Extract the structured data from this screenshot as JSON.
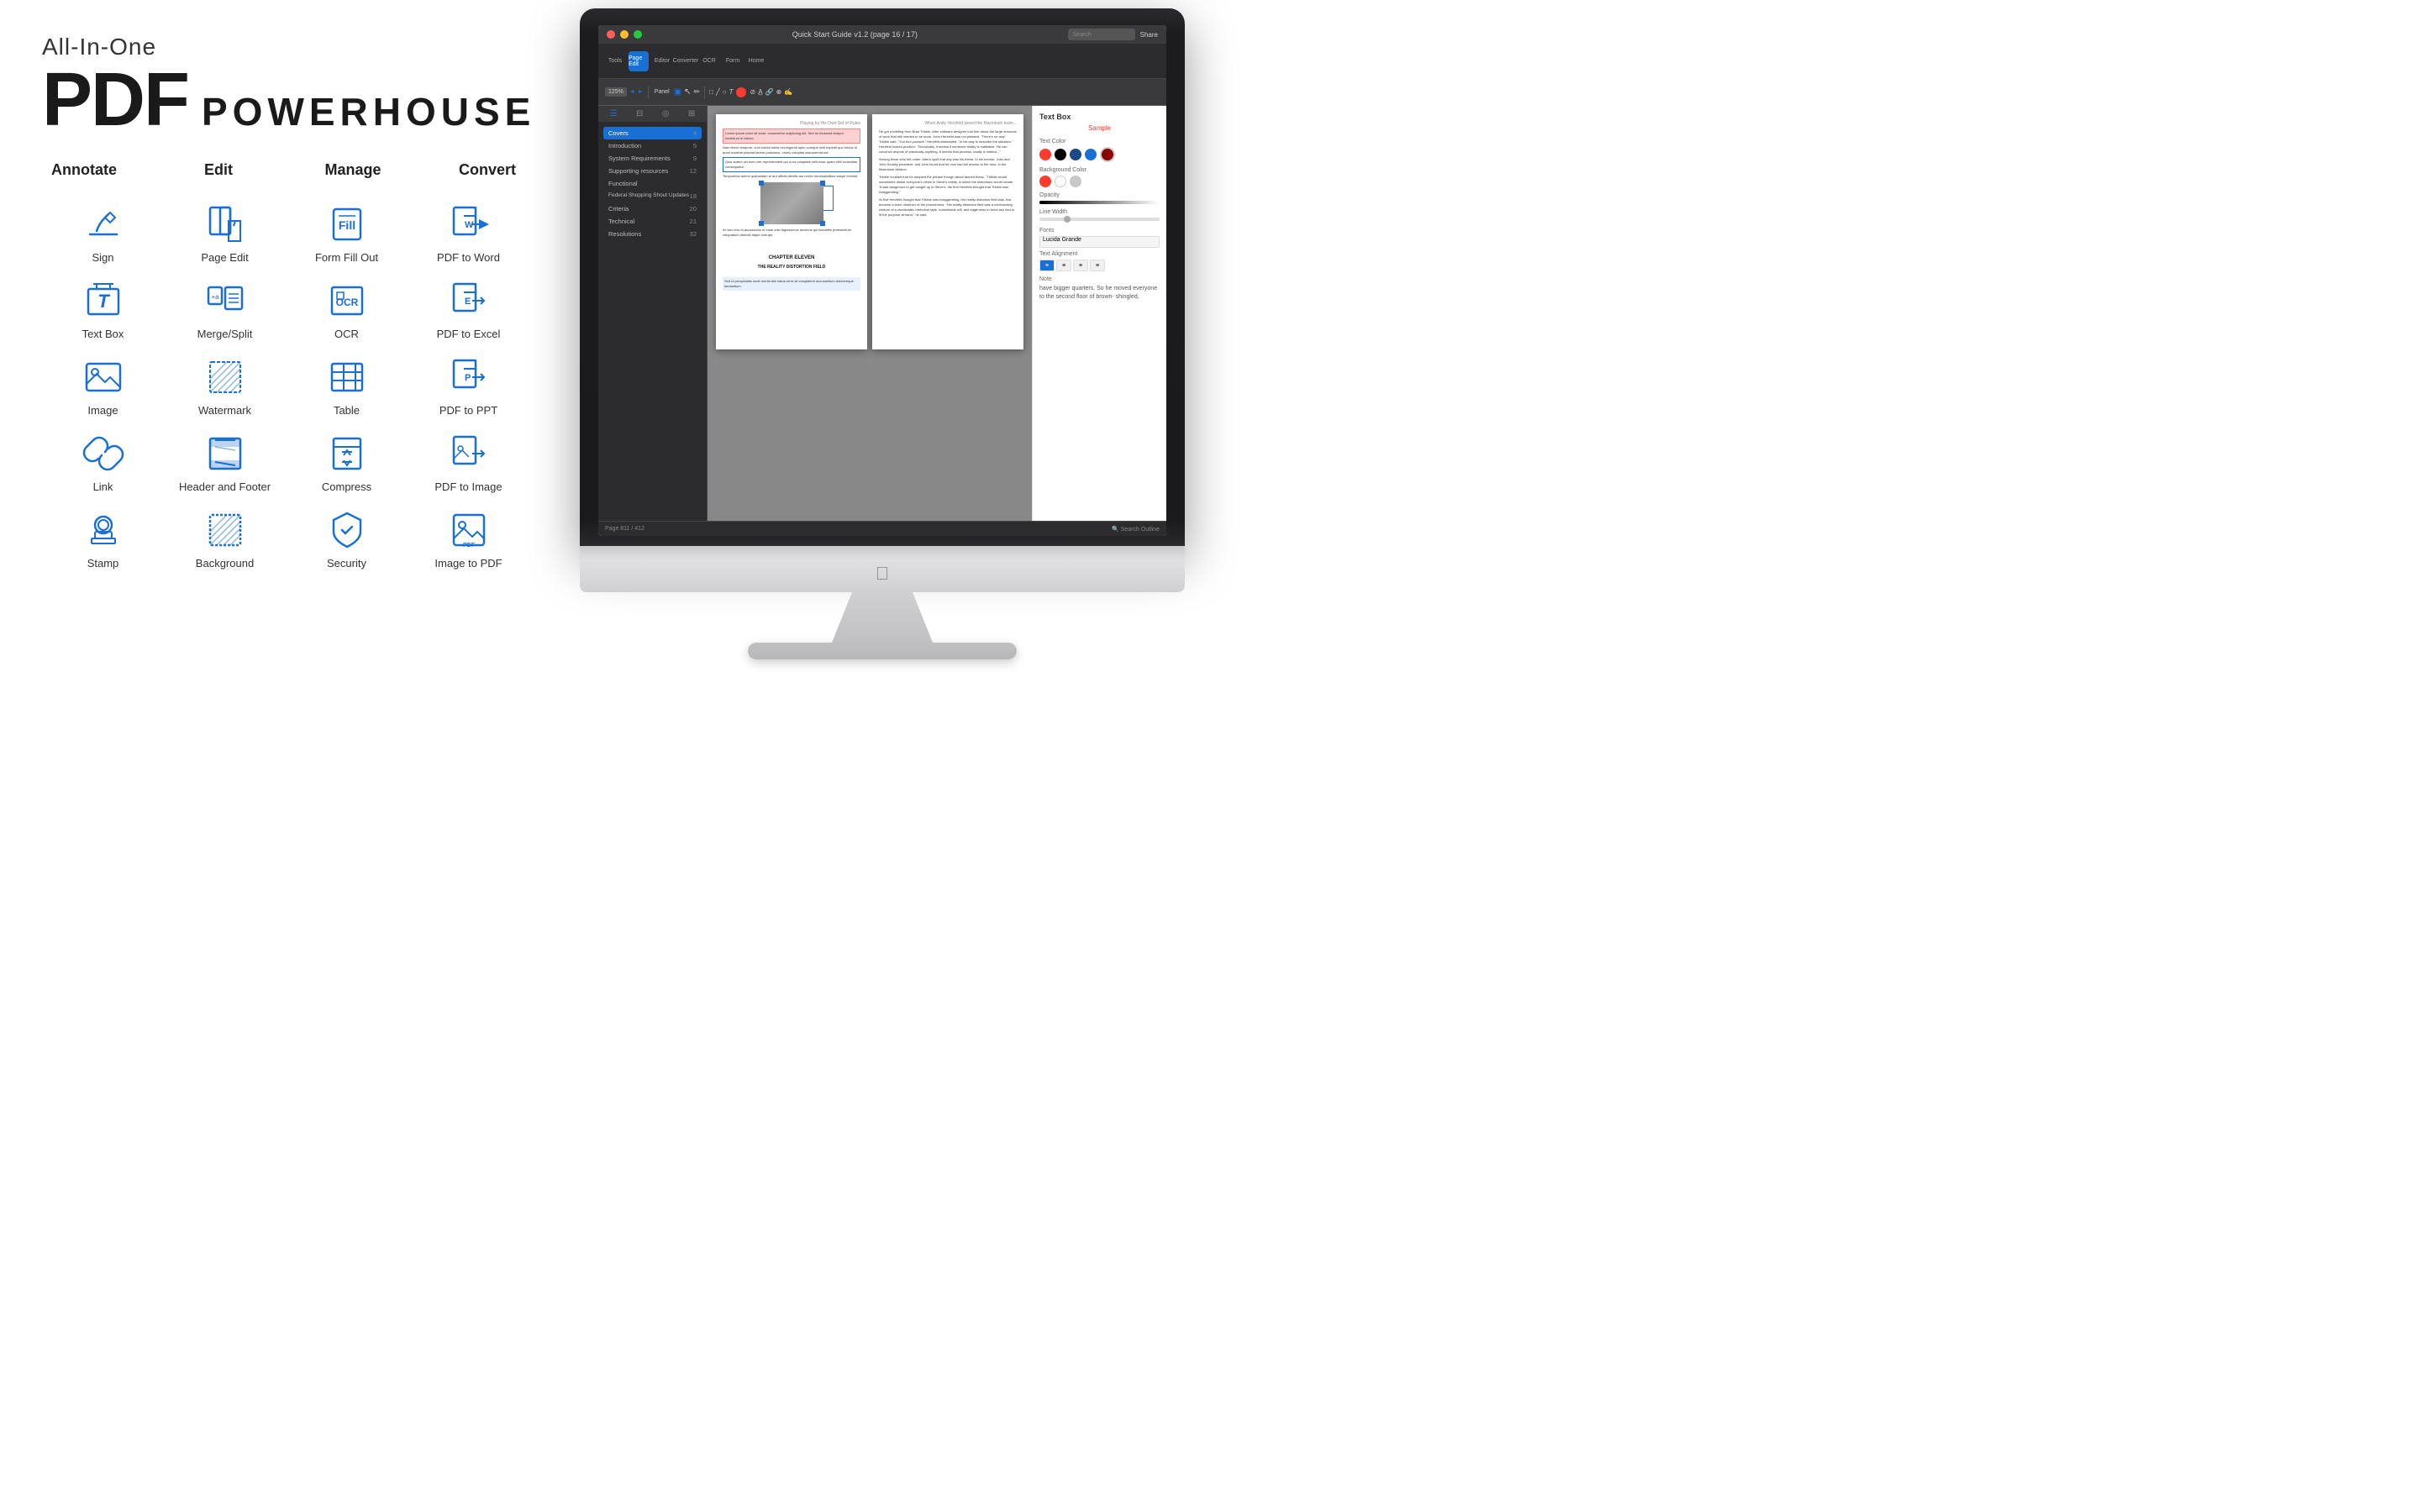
{
  "header": {
    "line1": "All-In-One",
    "line2": "PDF",
    "line3": "POWERHOUSE"
  },
  "categories": [
    {
      "id": "annotate",
      "label": "Annotate"
    },
    {
      "id": "edit",
      "label": "Edit"
    },
    {
      "id": "manage",
      "label": "Manage"
    },
    {
      "id": "convert",
      "label": "Convert"
    }
  ],
  "icon_rows": [
    [
      {
        "id": "sign",
        "label": "Sign",
        "category": "annotate"
      },
      {
        "id": "page-edit",
        "label": "Page Edit",
        "category": "edit"
      },
      {
        "id": "form-fill-out",
        "label": "Form Fill Out",
        "category": "manage"
      },
      {
        "id": "pdf-to-word",
        "label": "PDF to Word",
        "category": "convert"
      }
    ],
    [
      {
        "id": "text-box",
        "label": "Text Box",
        "category": "annotate"
      },
      {
        "id": "merge-split",
        "label": "Merge/Split",
        "category": "edit"
      },
      {
        "id": "ocr",
        "label": "OCR",
        "category": "manage"
      },
      {
        "id": "pdf-to-excel",
        "label": "PDF to Excel",
        "category": "convert"
      }
    ],
    [
      {
        "id": "image",
        "label": "Image",
        "category": "annotate"
      },
      {
        "id": "watermark",
        "label": "Watermark",
        "category": "edit"
      },
      {
        "id": "table",
        "label": "Table",
        "category": "manage"
      },
      {
        "id": "pdf-to-ppt",
        "label": "PDF to PPT",
        "category": "convert"
      }
    ],
    [
      {
        "id": "link",
        "label": "Link",
        "category": "annotate"
      },
      {
        "id": "header-footer",
        "label": "Header and Footer",
        "category": "edit"
      },
      {
        "id": "compress",
        "label": "Compress",
        "category": "manage"
      },
      {
        "id": "pdf-to-image",
        "label": "PDF to Image",
        "category": "convert"
      }
    ],
    [
      {
        "id": "stamp",
        "label": "Stamp",
        "category": "annotate"
      },
      {
        "id": "background",
        "label": "Background",
        "category": "edit"
      },
      {
        "id": "security",
        "label": "Security",
        "category": "manage"
      },
      {
        "id": "image-to-pdf",
        "label": "Image to PDF",
        "category": "convert"
      }
    ]
  ],
  "app": {
    "title": "Quick Start Guide v1.2 (page 16 / 17)",
    "page_info": "Page 811 / 412",
    "zoom": "125%",
    "search_placeholder": "Search",
    "right_panel_title": "Text Box",
    "sample_label": "Sample",
    "text_color_label": "Text Color",
    "bg_color_label": "Background Color",
    "opacity_label": "Opacity",
    "line_width_label": "Line Width",
    "fonts_label": "Fonts",
    "font_name": "Lucida Grande",
    "alignment_label": "Text Alignment",
    "note_label": "Note",
    "note_text": "have bigger quarters. So he moved everyone to the second floor of brown- shingled,",
    "toolbar_tabs": [
      "Tools",
      "Page Edit",
      "Editor",
      "Converter",
      "OCR",
      "Form",
      "Home"
    ],
    "sidebar_items": [
      {
        "label": "Covers",
        "page": "4"
      },
      {
        "label": "Introduction",
        "page": "5"
      },
      {
        "label": "System Requirements",
        "page": "9"
      },
      {
        "label": "Supporting resources",
        "page": "12"
      },
      {
        "label": "Functional",
        "page": ""
      },
      {
        "label": "Federal Shopping Shout Updates",
        "page": "18"
      },
      {
        "label": "Criteria",
        "page": "20"
      },
      {
        "label": "Technical",
        "page": "21"
      },
      {
        "label": "Resolutions",
        "page": "32"
      }
    ]
  },
  "colors": {
    "blue_primary": "#1a6fd4",
    "bg_white": "#ffffff",
    "text_dark": "#1a1a1a",
    "text_medium": "#333333"
  }
}
